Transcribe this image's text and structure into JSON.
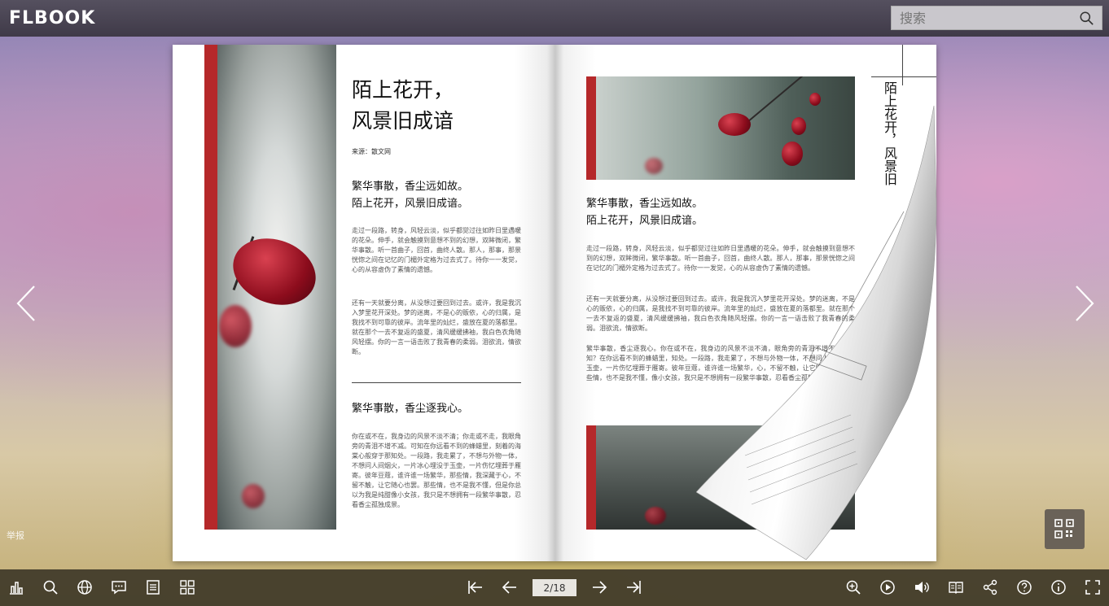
{
  "header": {
    "logo": "FLBOOK",
    "search_placeholder": "搜索"
  },
  "left_page": {
    "title_line1": "陌上花开，",
    "title_line2": "风景旧成谙",
    "source": "来源：散文网",
    "heading1_line1": "繁华事散，香尘远如故。",
    "heading1_line2": "陌上花开，风景旧成谙。",
    "body1": "走过一段路，转身，风轻云淡，似乎都觉过往如昨日里遇暖的花朵。伸手，就会触摸到意想不到的幻想，双眸微闭，繁华事散。听一首曲子，回首，曲终人散。那人，那事，那景恍惚之间在记忆的门楣外定格为过去式了。待你一一发觉，心的从容虚伪了素情的遗憾。",
    "body2": "还有一天就要分离，从没想过要回到过去。或许，我是我沉入梦里花开深处。梦的迷离，不是心的贩依，心的归属，是我找不到可靠的彼岸。流年里的灿烂，盛放在夏的落都里。就在那个一去不复返的盛夏，清风缓缓拂袖，我白色衣角随风轻摆。你的一言一语击败了我青春的柔弱。泪欲流，情欲断。",
    "heading2": "繁华事散，香尘逐我心。",
    "body3": "你在或不在，我身边的风景不淡不清；你走或不走，我眼角旁的青泪不增不减。可知在你远看不到的蜂蜡里，刻着的海棠心般穿于那知处。一段路，我走累了，不想与外物一体，不想问人间烟火，一片冰心埋没于玉壶，一片伤忆埋葬于雁寄。彼年豆蔻，谁许谁一场繁华，那些情，我深藏于心，不留不触，让它随心也罢。那些情，也不是我不懂，但是你总以为我是纯甜像小女孩，我只是不想拥有一段繁华事散，忍看香尘孤独成景。"
  },
  "right_page": {
    "heading1_line1": "繁华事散，香尘远如故。",
    "heading1_line2": "陌上花开，风景旧成谙。",
    "body1": "走过一段路，转身，风轻云淡，似乎都觉过往如昨日里遇暖的花朵。伸手，就会触摸到意想不到的幻想，双眸微闭，繁华事散。听一首曲子，回首，曲终人散。那人，那事，那景恍惚之间在记忆的门楣外定格为过去式了。待你一一发觉，心的从容虚伪了素情的遗憾。",
    "body2": "还有一天就要分离，从没想过要回到过去。或许，我是我沉入梦里花开深处。梦的迷离，不是心的贩依，心的归属，是我找不到可靠的彼岸。流年里的灿烂，盛放在夏的落都里。就在那个一去不复返的盛夏，清风缓缓拂袖，我白色衣角随风轻摆。你的一言一语击败了我青春的柔弱。泪欲流，情欲断。",
    "body3": "繁华事散，香尘逐我心。你在或不在，我身边的风景不淡不清，眼角旁的青泪不增不减。可知？在你远看不到的蜂蜡里，知处。一段路，我走累了，不想与外物一体，不想问人间烟火，玉壶，一片伤忆埋葬于雁寄。彼年豆蔻，谁许谁一场繁华，心，不留不触，让它随心也罢。那些情，也不是我不懂，像小女孩，我只是不想拥有一段繁华事散，忍看香尘孤独成景。",
    "vertical_title": "陌上花开，风景旧"
  },
  "overlay": {
    "report": "举报"
  },
  "toolbar": {
    "page_indicator": "2/18"
  }
}
